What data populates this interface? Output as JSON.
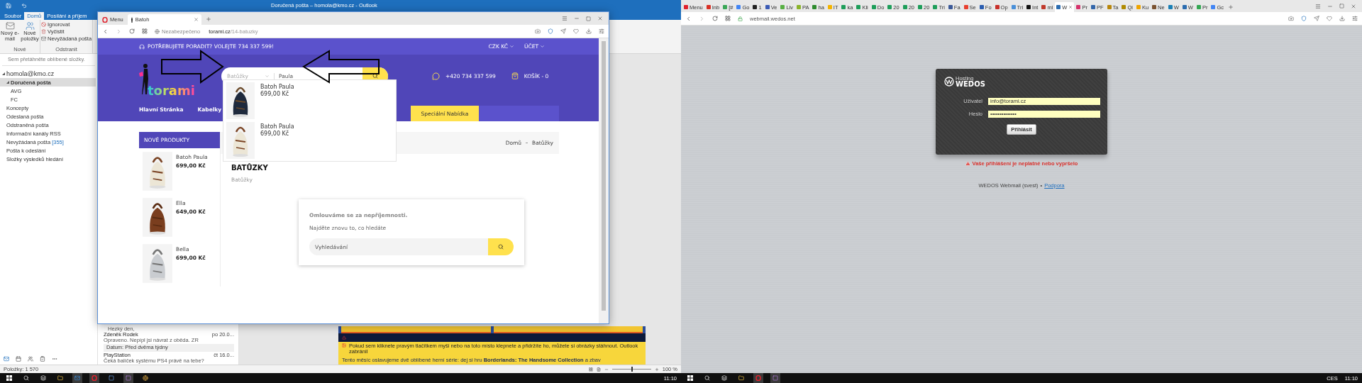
{
  "left_screen": {
    "outlook": {
      "title": "Doručená pošta – homola@kmo.cz - Outlook",
      "ribbon_tabs": [
        {
          "label": "Soubor",
          "selected": false
        },
        {
          "label": "Domů",
          "selected": true
        },
        {
          "label": "Posílání a příjem",
          "selected": false
        }
      ],
      "new_group": {
        "label": "Nové",
        "buttons": [
          {
            "label": "Nový e-mail",
            "kind": "mail"
          },
          {
            "label": "Nové položky",
            "kind": "items"
          }
        ]
      },
      "delete_group": {
        "label": "Odstranit",
        "buttons": [
          {
            "label": "Ignorovat",
            "kind": "ignore"
          },
          {
            "label": "Vyčistit",
            "kind": "clean"
          },
          {
            "label": "Nevyžádaná pošta",
            "kind": "junk"
          }
        ]
      },
      "favorites_hint": "Sem přetáhněte oblíbené složky.",
      "folders": [
        {
          "label": "homola@kmo.cz",
          "selected": false,
          "expanded": true,
          "children": [
            {
              "label": "Doručená pošta",
              "selected": true,
              "expanded": true,
              "children": [
                {
                  "label": "AVG",
                  "selected": false
                },
                {
                  "label": "FC",
                  "selected": false
                }
              ]
            },
            {
              "label": "Koncepty",
              "selected": false
            },
            {
              "label": "Odeslaná pošta",
              "selected": false
            },
            {
              "label": "Odstraněná pošta",
              "selected": false
            },
            {
              "label": "Informační kanály RSS",
              "selected": false
            },
            {
              "label": "Nevyžádaná pošta",
              "count": "[355]",
              "selected": false
            },
            {
              "label": "Pošta k odeslání",
              "selected": false
            },
            {
              "label": "Složky výsledků hledání",
              "selected": false
            }
          ]
        }
      ],
      "mail_list": [
        {
          "kind": "snippet",
          "text": "Hezký den,"
        },
        {
          "kind": "message",
          "sender": "Zdeněk Rodek",
          "date": "po 20.0...",
          "preview": "Opraveno. Nepípl jsi návrat z oběda.  ZR"
        },
        {
          "kind": "group",
          "label": "Datum: Před dvěma týdny"
        },
        {
          "kind": "message",
          "sender": "PlayStation",
          "date": "čt 16.0...",
          "preview": "Čeká balíček systému PS4 právě na tebe?"
        }
      ],
      "reading_pane": {
        "blocked_notice": "Pokud sem kliknete pravým tlačítkem myši nebo na toto místo klepnete a přidržíte ho, můžete si obrázky stáhnout. Outlook zabránil",
        "promo": "Tento měsíc oslavujeme dvě oblíbené herní série: dej si hru **Borderlands: The Handsome Collection** a zbav"
      },
      "status_bar": {
        "items": "Položky: 1 570",
        "zoom": "100 %",
        "zoom_slider": {
          "level": 0.5
        }
      }
    },
    "browser": {
      "tabs": [
        {
          "label": "Menu",
          "kind": "menu",
          "selected": false
        },
        {
          "label": "Batoh",
          "kind": "page",
          "selected": true
        }
      ],
      "address": {
        "security": "Nezabezpečeno",
        "host": "torami.cz",
        "path": "/14-batuzky"
      },
      "page": {
        "help_line": "POTŘEBUJETE PORADIT? VOLEJTE 734 337 599!",
        "currency": "CZK KČ",
        "account": "ÚČET",
        "logo": "torami",
        "search": {
          "category": "Batůžky",
          "value": "Paula"
        },
        "phone": "+420 734 337 599",
        "cart": "KOŠÍK - 0",
        "nav": [
          {
            "label": "Hlavní Stránka",
            "highlighted": false
          },
          {
            "label": "Kabelky",
            "highlighted": false
          },
          {
            "label": "Speciální Nabídka",
            "highlighted": true
          }
        ],
        "suggestions": [
          {
            "name": "Batoh Paula",
            "price": "699,00 Kč"
          },
          {
            "name": "Batoh Paula",
            "price": "699,00 Kč"
          }
        ],
        "sidebar": {
          "title": "NOVÉ PRODUKTY",
          "products": [
            {
              "name": "Batoh Paula",
              "price": "699,00 Kč"
            },
            {
              "name": "Ella",
              "price": "649,00 Kč"
            },
            {
              "name": "Bella",
              "price": "699,00 Kč"
            }
          ]
        },
        "breadcrumb": [
          "Domů",
          "Batůžky"
        ],
        "heading": "BATŮZKY",
        "subheading": "Batůžky",
        "notice": {
          "title": "Omlouváme se za nepříjemnosti.",
          "text": "Najděte znovu to, co hledáte",
          "search_placeholder": "Vyhledávání"
        }
      }
    },
    "taskbar": {
      "time": "11:10"
    }
  },
  "right_screen": {
    "browser": {
      "tabs": [
        {
          "label": "Menu",
          "color": "#e0232e",
          "selected": false
        },
        {
          "label": "Inb",
          "color": "#d93025",
          "selected": false
        },
        {
          "label": "[#",
          "color": "#3aa757",
          "selected": false
        },
        {
          "label": "Go",
          "color": "#4285f4",
          "selected": false
        },
        {
          "label": "1",
          "color": "#222222",
          "selected": false
        },
        {
          "label": "Ve",
          "color": "#3b5bb5",
          "selected": false
        },
        {
          "label": "Liv",
          "color": "#58b044",
          "selected": false
        },
        {
          "label": "PA",
          "color": "#8bb42b",
          "selected": false
        },
        {
          "label": "ha",
          "color": "#2e8b2e",
          "selected": false
        },
        {
          "label": "IT",
          "color": "#f4b400",
          "selected": false
        },
        {
          "label": "ka",
          "color": "#1e9e5a",
          "selected": false
        },
        {
          "label": "Kli",
          "color": "#1e9e5a",
          "selected": false
        },
        {
          "label": "Do",
          "color": "#1e9e5a",
          "selected": false
        },
        {
          "label": "20",
          "color": "#1e9e5a",
          "selected": false
        },
        {
          "label": "20",
          "color": "#1e9e5a",
          "selected": false
        },
        {
          "label": "20",
          "color": "#1e9e5a",
          "selected": false
        },
        {
          "label": "Tri",
          "color": "#1e9e5a",
          "selected": false
        },
        {
          "label": "Fa",
          "color": "#3b5998",
          "selected": false
        },
        {
          "label": "Se",
          "color": "#e8402f",
          "selected": false
        },
        {
          "label": "Fo",
          "color": "#2a5db0",
          "selected": false
        },
        {
          "label": "Op",
          "color": "#c8302a",
          "selected": false
        },
        {
          "label": "Tri",
          "color": "#4a90d9",
          "selected": false
        },
        {
          "label": "Int",
          "color": "#111111",
          "selected": false
        },
        {
          "label": "ml",
          "color": "#c0392b",
          "selected": false
        },
        {
          "label": "W",
          "color": "#2b6cb0",
          "selected": true
        },
        {
          "label": "Pr",
          "color": "#d6336c",
          "selected": false
        },
        {
          "label": "PF",
          "color": "#3366aa",
          "selected": false
        },
        {
          "label": "Ta",
          "color": "#b8860b",
          "selected": false
        },
        {
          "label": "Qi",
          "color": "#b08a00",
          "selected": false
        },
        {
          "label": "Ku",
          "color": "#f0a500",
          "selected": false
        },
        {
          "label": "Ne",
          "color": "#7a5230",
          "selected": false
        },
        {
          "label": "W",
          "color": "#1a7fb5",
          "selected": false
        },
        {
          "label": "W",
          "color": "#2b6cb0",
          "selected": false
        },
        {
          "label": "Pr",
          "color": "#34a853",
          "selected": false
        },
        {
          "label": "Gc",
          "color": "#4285f4",
          "selected": false
        }
      ],
      "url": "webmail.wedos.net"
    },
    "login": {
      "logo_small": "Hosting",
      "logo": "WEDOS",
      "fields": [
        {
          "label": "Uživatel",
          "value": "info@torami.cz"
        },
        {
          "label": "Heslo",
          "value": "••••••••••••••"
        }
      ],
      "button": "Přihlásit",
      "error": "Vaše přihlášení je neplatné nebo vypršelo",
      "footer": "WEDOS Webmail (svest)",
      "footer_sep": "•",
      "support_link": "Podpora"
    },
    "taskbar": {
      "language": "CES",
      "time": "11:10"
    }
  }
}
